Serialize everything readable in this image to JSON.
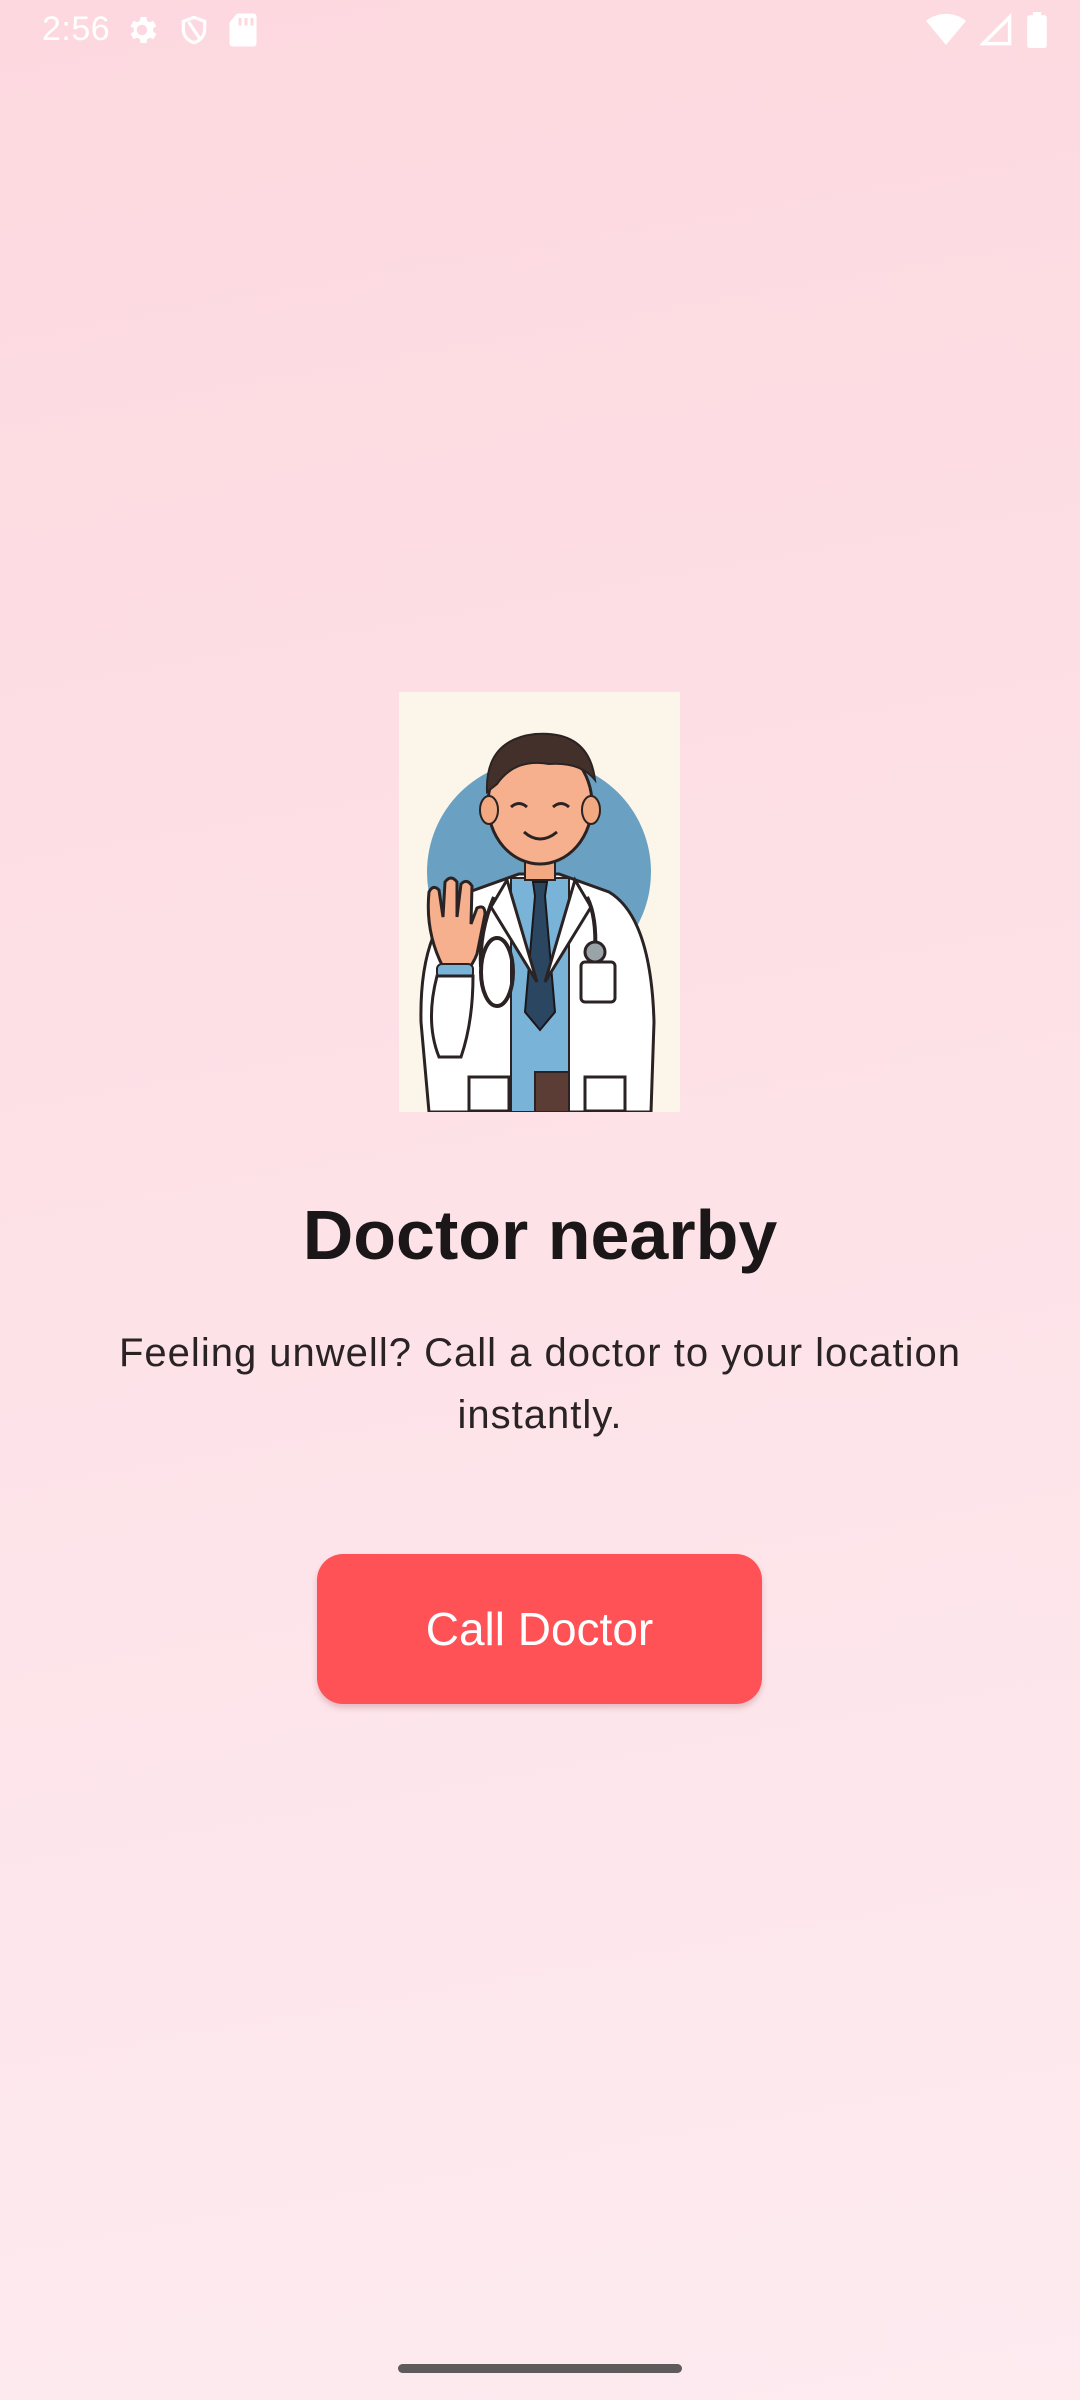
{
  "status_bar": {
    "time": "2:56",
    "left_icons": [
      "settings-gear-icon",
      "shield-icon",
      "sd-card-icon"
    ],
    "right_icons": [
      "wifi-icon",
      "cell-signal-icon",
      "battery-icon"
    ]
  },
  "main": {
    "illustration": "doctor-waving-illustration",
    "title": "Doctor nearby",
    "subtitle": "Feeling unwell? Call a doctor to your location instantly.",
    "button_label": "Call Doctor"
  },
  "colors": {
    "background_top": "#fdd8df",
    "background_bottom": "#fdebf0",
    "button": "#fe5257",
    "title_text": "#1b1719"
  }
}
